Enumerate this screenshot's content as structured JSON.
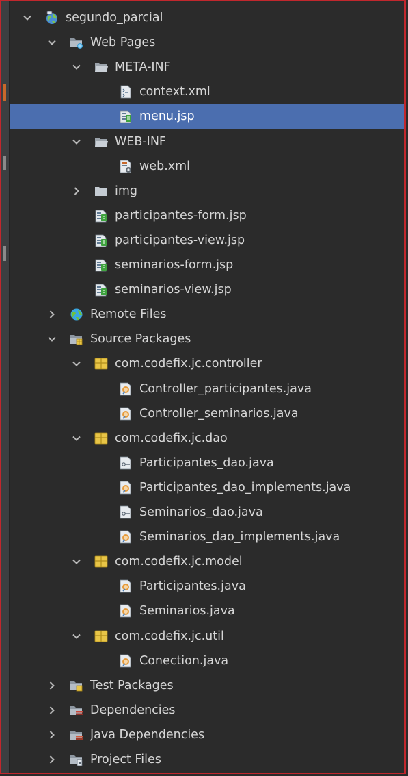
{
  "panel": "projects-tree",
  "colors": {
    "background": "#2b2b2b",
    "selection": "#4b6eaf",
    "border": "#c1272d",
    "package": "#e8c547"
  },
  "tree": [
    {
      "label": "segundo_parcial",
      "depth": 0,
      "expanded": true,
      "icon": "globe-icon"
    },
    {
      "label": "Web Pages",
      "depth": 1,
      "expanded": true,
      "icon": "web-folder-icon"
    },
    {
      "label": "META-INF",
      "depth": 2,
      "expanded": true,
      "icon": "folder-open-icon"
    },
    {
      "label": "context.xml",
      "depth": 3,
      "icon": "xml-file-icon"
    },
    {
      "label": "menu.jsp",
      "depth": 3,
      "icon": "jsp-file-icon",
      "selected": true
    },
    {
      "label": "WEB-INF",
      "depth": 2,
      "expanded": true,
      "icon": "folder-open-icon"
    },
    {
      "label": "web.xml",
      "depth": 3,
      "icon": "webxml-file-icon"
    },
    {
      "label": "img",
      "depth": 2,
      "expanded": false,
      "icon": "folder-icon"
    },
    {
      "label": "participantes-form.jsp",
      "depth": 2,
      "icon": "jsp-file-icon"
    },
    {
      "label": "participantes-view.jsp",
      "depth": 2,
      "icon": "jsp-file-icon"
    },
    {
      "label": "seminarios-form.jsp",
      "depth": 2,
      "icon": "jsp-file-icon"
    },
    {
      "label": "seminarios-view.jsp",
      "depth": 2,
      "icon": "jsp-file-icon"
    },
    {
      "label": "Remote Files",
      "depth": 1,
      "expanded": false,
      "icon": "remote-files-icon"
    },
    {
      "label": "Source Packages",
      "depth": 1,
      "expanded": true,
      "icon": "source-packages-icon"
    },
    {
      "label": "com.codefix.jc.controller",
      "depth": 2,
      "expanded": true,
      "icon": "package-icon"
    },
    {
      "label": "Controller_participantes.java",
      "depth": 3,
      "icon": "java-class-icon"
    },
    {
      "label": "Controller_seminarios.java",
      "depth": 3,
      "icon": "java-class-icon"
    },
    {
      "label": "com.codefix.jc.dao",
      "depth": 2,
      "expanded": true,
      "icon": "package-icon"
    },
    {
      "label": "Participantes_dao.java",
      "depth": 3,
      "icon": "java-interface-icon"
    },
    {
      "label": "Participantes_dao_implements.java",
      "depth": 3,
      "icon": "java-class-icon"
    },
    {
      "label": "Seminarios_dao.java",
      "depth": 3,
      "icon": "java-interface-icon"
    },
    {
      "label": "Seminarios_dao_implements.java",
      "depth": 3,
      "icon": "java-class-icon"
    },
    {
      "label": "com.codefix.jc.model",
      "depth": 2,
      "expanded": true,
      "icon": "package-icon"
    },
    {
      "label": "Participantes.java",
      "depth": 3,
      "icon": "java-class-icon"
    },
    {
      "label": "Seminarios.java",
      "depth": 3,
      "icon": "java-class-icon"
    },
    {
      "label": "com.codefix.jc.util",
      "depth": 2,
      "expanded": true,
      "icon": "package-icon"
    },
    {
      "label": "Conection.java",
      "depth": 3,
      "icon": "java-class-icon"
    },
    {
      "label": "Test Packages",
      "depth": 1,
      "expanded": false,
      "icon": "test-packages-icon"
    },
    {
      "label": "Dependencies",
      "depth": 1,
      "expanded": false,
      "icon": "dependencies-icon"
    },
    {
      "label": "Java Dependencies",
      "depth": 1,
      "expanded": false,
      "icon": "java-dependencies-icon"
    },
    {
      "label": "Project Files",
      "depth": 1,
      "expanded": false,
      "icon": "project-files-icon"
    }
  ]
}
